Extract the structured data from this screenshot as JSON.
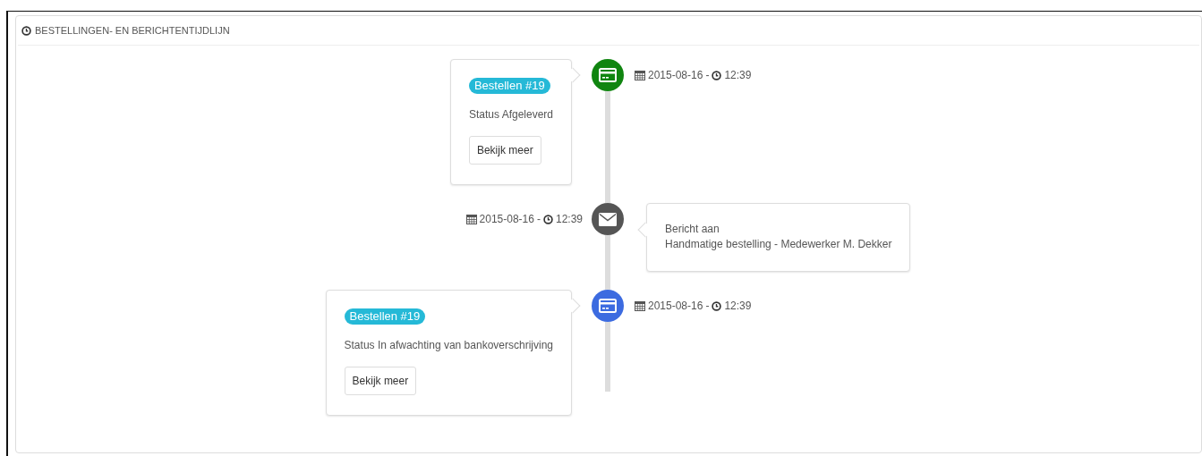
{
  "panel": {
    "title": "BESTELLINGEN- EN BERICHTENTIJDLIJN"
  },
  "timeline": [
    {
      "kind": "order",
      "color": "#108510",
      "badge": "Bestellen #19",
      "status": "Status Afgeleverd",
      "button": "Bekijk meer",
      "date": "2015-08-16",
      "separator": "-",
      "time": "12:39"
    },
    {
      "kind": "message",
      "color": "#555555",
      "lines": [
        "Bericht aan",
        "Handmatige bestelling - Medewerker M. Dekker"
      ],
      "date": "2015-08-16",
      "separator": "-",
      "time": "12:39"
    },
    {
      "kind": "order",
      "color": "#3c6be0",
      "badge": "Bestellen #19",
      "status": "Status In afwachting van bankoverschrijving",
      "button": "Bekijk meer",
      "date": "2015-08-16",
      "separator": "-",
      "time": "12:39"
    }
  ]
}
